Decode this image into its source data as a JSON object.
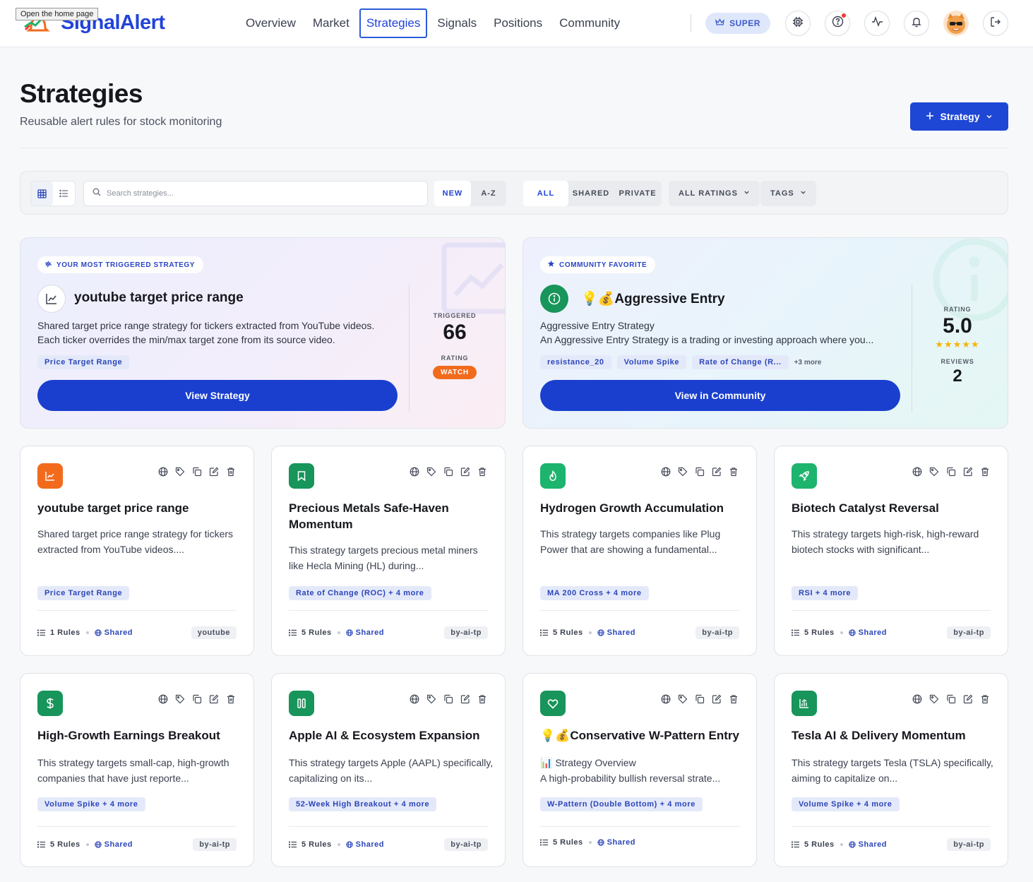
{
  "tooltip": "Open the home page",
  "brand": {
    "name": "SignalAlert"
  },
  "nav": [
    "Overview",
    "Market",
    "Strategies",
    "Signals",
    "Positions",
    "Community"
  ],
  "nav_active": "Strategies",
  "header": {
    "super_label": "SUPER"
  },
  "page": {
    "title": "Strategies",
    "subtitle": "Reusable alert rules for stock monitoring",
    "new_button": "Strategy"
  },
  "filters": {
    "search_placeholder": "Search strategies...",
    "sort": [
      "NEW",
      "A-Z"
    ],
    "visibility": [
      "ALL",
      "SHARED",
      "PRIVATE"
    ],
    "ratings": "ALL RATINGS",
    "tags": "TAGS"
  },
  "featured": [
    {
      "badge": "YOUR MOST TRIGGERED STRATEGY",
      "title": "youtube target price range",
      "description": "Shared target price range strategy for tickers extracted from YouTube videos. Each ticker overrides the min/max target zone from its source video.",
      "tags": [
        "Price Target Range"
      ],
      "button": "View Strategy",
      "stat1_label": "TRIGGERED",
      "stat1_value": "66",
      "stat2_label": "RATING",
      "stat2_badge": "WATCH"
    },
    {
      "badge": "COMMUNITY FAVORITE",
      "title": "💡💰Aggressive Entry",
      "description": "Aggressive Entry Strategy\nAn Aggressive Entry Strategy is a trading or investing approach where you...",
      "tags": [
        "resistance_20",
        "Volume Spike",
        "Rate of Change (R..."
      ],
      "more": "+3 more",
      "button": "View in Community",
      "stat1_label": "RATING",
      "stat1_value": "5.0",
      "stars": "★★★★★",
      "rating": 5.0,
      "stat2_label": "REVIEWS",
      "stat2_value": "2"
    }
  ],
  "cards": [
    {
      "title": "youtube target price range",
      "description": "Shared target price range strategy for tickers extracted from YouTube videos....",
      "tag": "Price Target Range",
      "rules": "1 Rules",
      "visibility": "Shared",
      "author": "youtube",
      "icon": "chart-line-icon",
      "color": "#f26b1d"
    },
    {
      "title": "Precious Metals Safe-Haven Momentum",
      "description": "This strategy targets precious metal miners like Hecla Mining (HL) during...",
      "tag": "Rate of Change (ROC) + 4 more",
      "rules": "5 Rules",
      "visibility": "Shared",
      "author": "by-ai-tp",
      "icon": "bookmark-icon",
      "color": "#17955a"
    },
    {
      "title": "Hydrogen Growth Accumulation",
      "description": "This strategy targets companies like Plug Power that are showing a fundamental...",
      "tag": "MA 200 Cross + 4 more",
      "rules": "5 Rules",
      "visibility": "Shared",
      "author": "by-ai-tp",
      "icon": "flame-icon",
      "color": "#1db46e"
    },
    {
      "title": "Biotech Catalyst Reversal",
      "description": "This strategy targets high-risk, high-reward biotech stocks with significant...",
      "tag": "RSI + 4 more",
      "rules": "5 Rules",
      "visibility": "Shared",
      "author": "by-ai-tp",
      "icon": "rocket-icon",
      "color": "#1db46e"
    },
    {
      "title": "High-Growth Earnings Breakout",
      "description": "This strategy targets small-cap, high-growth companies that have just reporte...",
      "tag": "Volume Spike + 4 more",
      "rules": "5 Rules",
      "visibility": "Shared",
      "author": "by-ai-tp",
      "icon": "dollar-icon",
      "color": "#17955a"
    },
    {
      "title": "Apple AI & Ecosystem Expansion",
      "description": "This strategy targets Apple (AAPL) specifically, capitalizing on its...",
      "tag": "52-Week High Breakout + 4 more",
      "rules": "5 Rules",
      "visibility": "Shared",
      "author": "by-ai-tp",
      "icon": "pause-icon",
      "color": "#17955a"
    },
    {
      "title": "💡💰Conservative W-Pattern Entry",
      "description": "📊 Strategy Overview\nA high-probability bullish reversal strate...",
      "tag": "W-Pattern (Double Bottom) + 4 more",
      "rules": "5 Rules",
      "visibility": "Shared",
      "author": "",
      "icon": "heart-icon",
      "color": "#17955a"
    },
    {
      "title": "Tesla AI & Delivery Momentum",
      "description": "This strategy targets Tesla (TSLA) specifically, aiming to capitalize on...",
      "tag": "Volume Spike + 4 more",
      "rules": "5 Rules",
      "visibility": "Shared",
      "author": "by-ai-tp",
      "icon": "chart-bars-icon",
      "color": "#17955a"
    }
  ]
}
